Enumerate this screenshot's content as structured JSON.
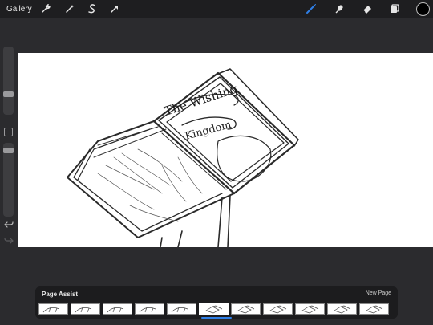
{
  "topbar": {
    "gallery_label": "Gallery",
    "left_tools": [
      "wrench-icon",
      "magic-wand-icon",
      "selection-s-icon",
      "transform-arrow-icon"
    ],
    "right_tools": [
      "brush-icon",
      "smudge-icon",
      "eraser-icon",
      "layers-icon"
    ],
    "active_tool": "brush-icon",
    "accent_color": "#2f7fe6",
    "current_color": "#000000"
  },
  "sidebar": {
    "brush_size_level": 0.75,
    "opacity_level": 0.2,
    "undo_icon": "undo-icon",
    "redo_icon": "redo-icon"
  },
  "page_assist": {
    "title": "Page Assist",
    "new_page_label": "New Page",
    "page_count": 11,
    "selected_page": 6
  },
  "canvas": {
    "sketch_text_line1": "The Wishing",
    "sketch_text_line2": "Kingdom"
  }
}
